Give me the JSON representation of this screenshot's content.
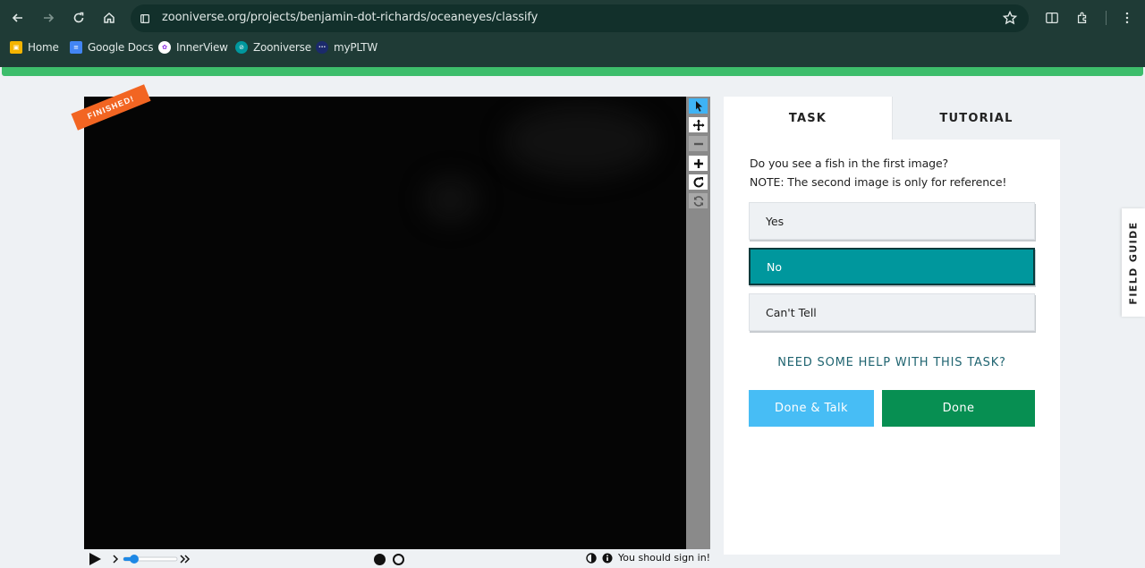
{
  "browser": {
    "url": "zooniverse.org/projects/benjamin-dot-richards/oceaneyes/classify",
    "bookmarks": [
      {
        "label": "Home",
        "icon": "home-bookmark-icon",
        "color": "#f4b400"
      },
      {
        "label": "Google Docs",
        "icon": "google-docs-icon",
        "color": "#4285f4"
      },
      {
        "label": "InnerView",
        "icon": "innerview-icon",
        "color": "#ffffff"
      },
      {
        "label": "Zooniverse",
        "icon": "zooniverse-icon",
        "color": "#00979d"
      },
      {
        "label": "myPLTW",
        "icon": "mypltw-icon",
        "color": "#1b2a6b"
      }
    ]
  },
  "viewer": {
    "badge": "FINISHED!",
    "tools": [
      "pointer-icon",
      "pan-icon",
      "zoom-out-icon",
      "zoom-in-icon",
      "rotate-icon",
      "reset-icon"
    ],
    "status": "You should sign in!"
  },
  "task": {
    "tabs": {
      "task": "TASK",
      "tutorial": "TUTORIAL"
    },
    "question_line1": "Do you see a fish in the first image?",
    "question_line2": "NOTE: The second image is only for reference!",
    "answers": [
      "Yes",
      "No",
      "Can't Tell"
    ],
    "selected_answer": "No",
    "help": "NEED SOME HELP WITH THIS TASK?",
    "done_talk": "Done & Talk",
    "done": "Done"
  },
  "field_guide": "FIELD GUIDE",
  "colors": {
    "accent_teal": "#00979d",
    "done_green": "#078f52",
    "done_talk_blue": "#47bdf5",
    "progress_green": "#3dbd6b",
    "badge_orange": "#f26522"
  }
}
